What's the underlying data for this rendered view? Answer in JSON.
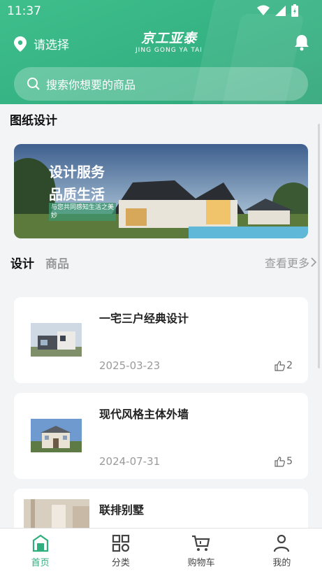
{
  "status_bar": {
    "time": "11:37"
  },
  "header": {
    "location_label": "请选择",
    "brand_cn": "京工亚泰",
    "brand_en": "JING GONG YA TAI",
    "search_placeholder": "搜索你想要的商品"
  },
  "section": {
    "title": "图纸设计"
  },
  "banner": {
    "line1": "设计服务",
    "line2": "品质生活",
    "line3": "与您共同感知生活之美妙"
  },
  "tabs": [
    {
      "label": "设计"
    },
    {
      "label": "商品"
    }
  ],
  "more_label": "查看更多",
  "cards": [
    {
      "title": "一宅三户经典设计",
      "date": "2025-03-23",
      "likes": "2"
    },
    {
      "title": "现代风格主体外墙",
      "date": "2024-07-31",
      "likes": "5"
    },
    {
      "title": "联排别墅",
      "date": "",
      "likes": ""
    }
  ],
  "tabbar": [
    {
      "label": "首页"
    },
    {
      "label": "分类"
    },
    {
      "label": "购物车"
    },
    {
      "label": "我的"
    }
  ],
  "colors": {
    "accent": "#2fae7e",
    "header": "#3bb887"
  }
}
